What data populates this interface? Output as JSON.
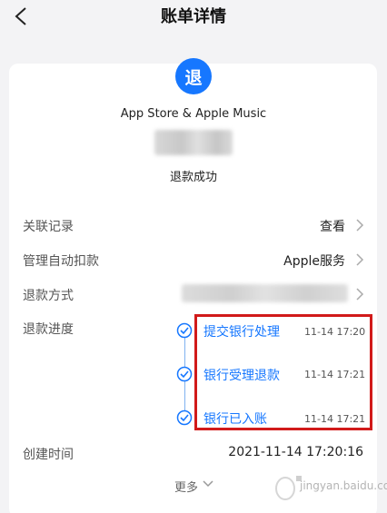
{
  "header": {
    "title": "账单详情"
  },
  "summary": {
    "badge": "退",
    "merchant": "App Store & Apple Music",
    "status": "退款成功"
  },
  "rows": {
    "related": {
      "label": "关联记录",
      "value": "查看"
    },
    "auto_pay": {
      "label": "管理自动扣款",
      "value": "Apple服务"
    },
    "refund_method": {
      "label": "退款方式"
    },
    "progress": {
      "label": "退款进度"
    },
    "created": {
      "label": "创建时间",
      "value": "2021-11-14 17:20:16"
    }
  },
  "timeline": [
    {
      "text": "提交银行处理",
      "time": "11-14 17:20"
    },
    {
      "text": "银行受理退款",
      "time": "11-14 17:21"
    },
    {
      "text": "银行已入账",
      "time": "11-14 17:21"
    }
  ],
  "footer": {
    "more": "更多"
  },
  "watermark": {
    "text": "jingyan.baidu.com"
  },
  "colors": {
    "accent": "#1677ff",
    "highlight": "#d11a1a"
  }
}
